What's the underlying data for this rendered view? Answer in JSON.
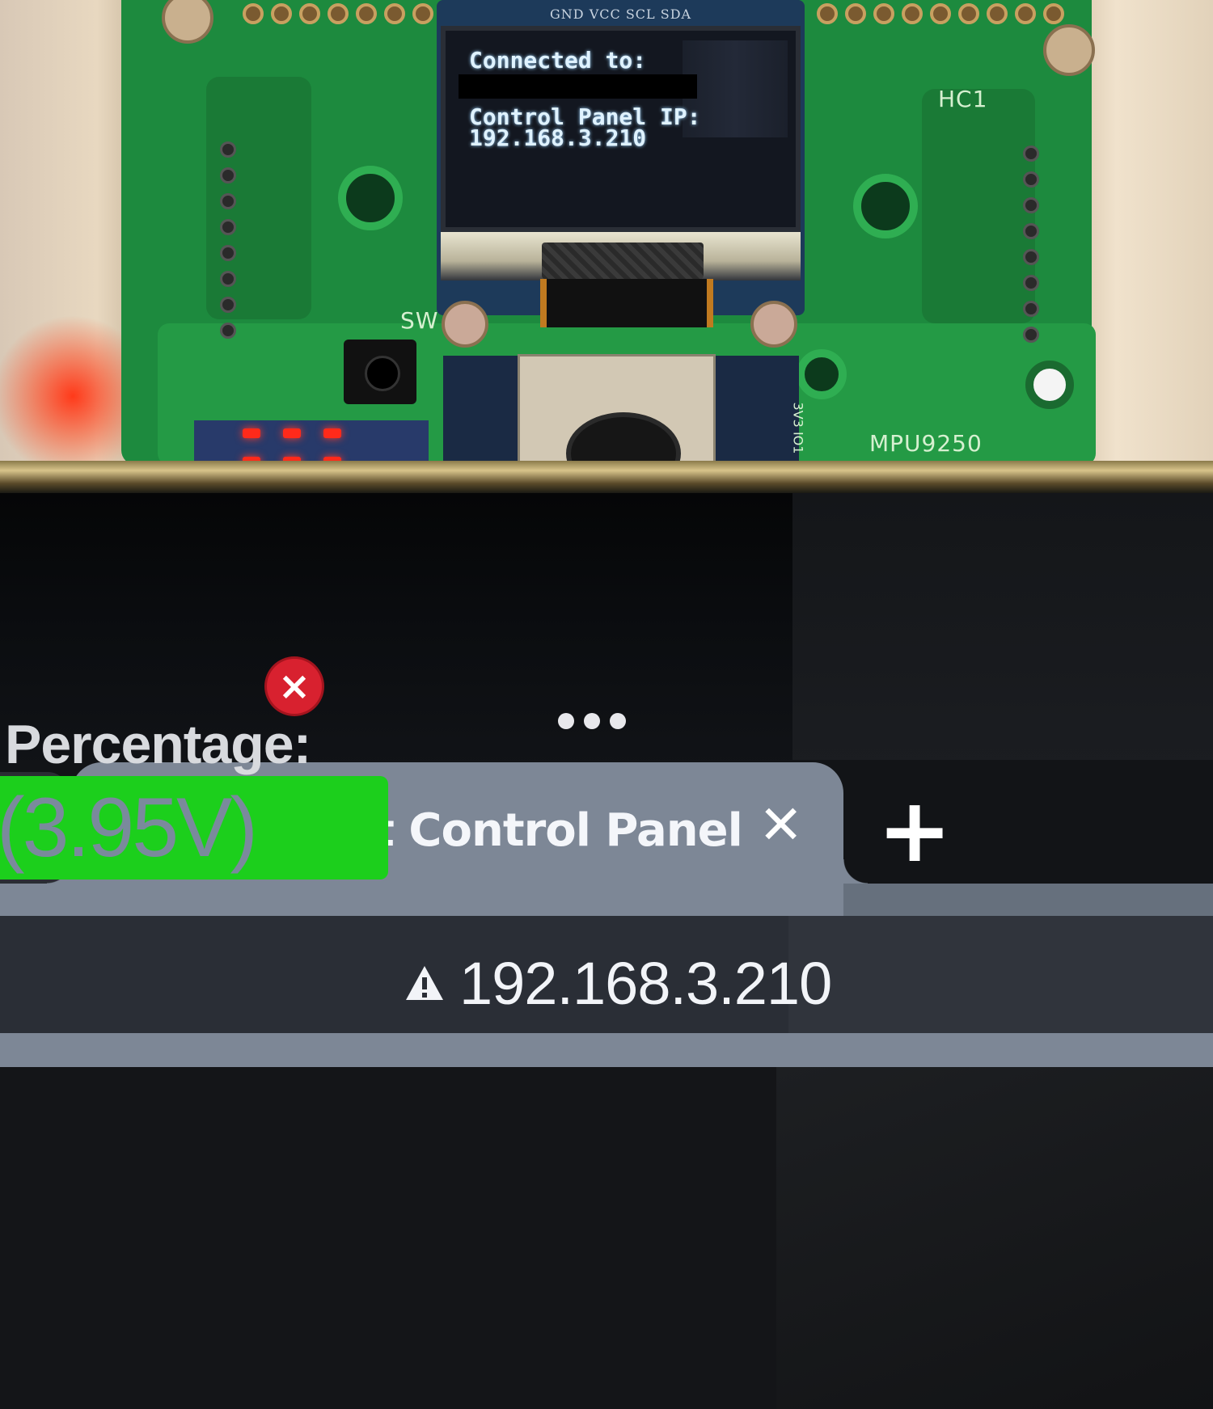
{
  "oled": {
    "line1": "Connected to:",
    "line2": "Control Panel IP:\n192.168.3.210",
    "pin_label": "GND VCC SCL SDA"
  },
  "board": {
    "sensor_label": "MPU9250",
    "switch_label": "SW",
    "cam_pin_label": "3V3 IO1",
    "hc_label_right": "HC1"
  },
  "browser": {
    "menu_icon": "more-dots-icon",
    "tabs": [
      {
        "title": "",
        "close_label": "✕",
        "active": false
      },
      {
        "title": "CubeSat Control Panel",
        "close_label": "✕",
        "active": true,
        "icon": "globe-icon"
      }
    ],
    "new_tab_label": "+",
    "address": {
      "security_icon": "warning-triangle-icon",
      "url": "192.168.3.210"
    }
  },
  "page": {
    "error_badge_label": "×",
    "battery_label": "Percentage:",
    "battery_value": "(3.95V)",
    "battery_color": "#1ccf1c"
  },
  "colors": {
    "tab_active": "#7d8796",
    "address_bar": "#2a2e36",
    "error": "#d8212f",
    "pcb": "#1d8a3e"
  }
}
